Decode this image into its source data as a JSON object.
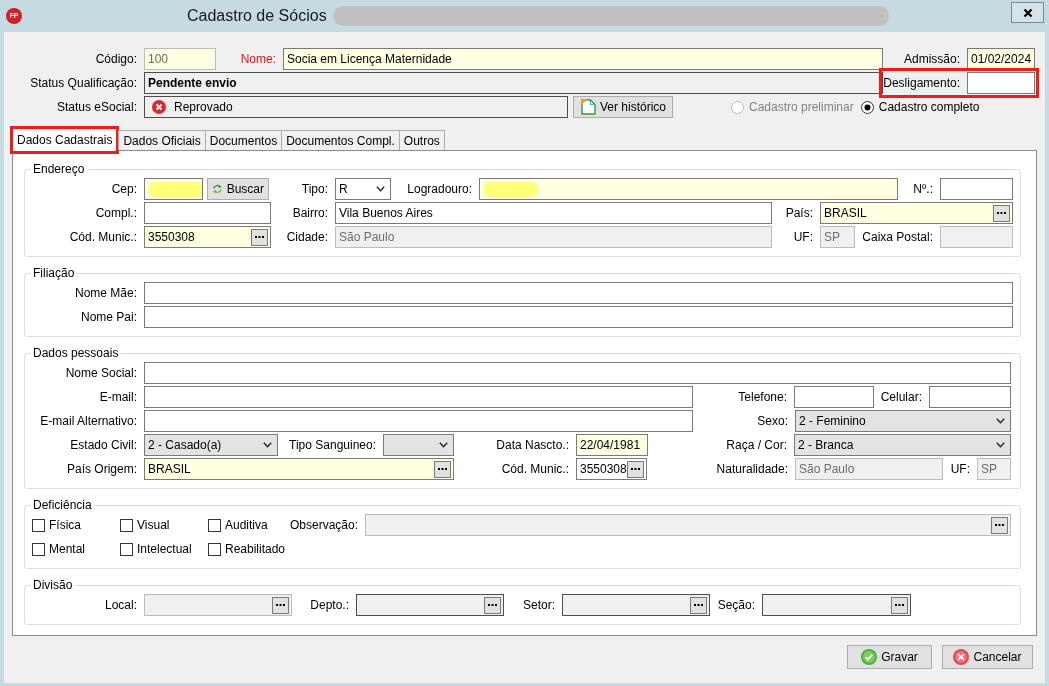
{
  "window": {
    "badge": "FP",
    "title": "Cadastro de Sócios",
    "title_redacted": true
  },
  "header": {
    "fields": [
      {
        "label": "Código:",
        "value": "100",
        "kind": "text",
        "required": true,
        "disabled": true,
        "read_only": false,
        "label_alert": false,
        "highlighted": false
      },
      {
        "label": "Nome:",
        "value": "Socia em Licença Maternidade",
        "kind": "text",
        "required": true,
        "disabled": false,
        "read_only": false,
        "label_alert": true,
        "highlighted": false
      },
      {
        "label": "Admissão:",
        "value": "01/02/2024",
        "kind": "text",
        "required": true,
        "disabled": false,
        "read_only": false,
        "label_alert": false,
        "highlighted": false
      },
      {
        "label": "Status Qualificação:",
        "value": "Pendente envio",
        "kind": "display",
        "required": false,
        "disabled": false,
        "read_only": true,
        "label_alert": false,
        "highlighted": false
      },
      {
        "label": "Desligamento:",
        "kind": "text",
        "required": false,
        "disabled": false,
        "read_only": false,
        "label_alert": false,
        "highlighted": true
      },
      {
        "label": "Status eSocial:",
        "value": "Reprovado",
        "kind": "error-status",
        "required": false,
        "disabled": false,
        "read_only": true,
        "label_alert": false,
        "highlighted": false
      }
    ],
    "history_button": "Ver histórico",
    "registration_modes": [
      {
        "label": "Cadastro preliminar",
        "selected": false,
        "disabled": true
      },
      {
        "label": "Cadastro completo",
        "selected": true,
        "disabled": false
      }
    ]
  },
  "tabs": [
    {
      "label": "Dados Cadastrais",
      "selected": true,
      "highlighted": true
    },
    {
      "label": "Dados Oficiais",
      "selected": false,
      "highlighted": false
    },
    {
      "label": "Documentos",
      "selected": false,
      "highlighted": false
    },
    {
      "label": "Documentos Compl.",
      "selected": false,
      "highlighted": false
    },
    {
      "label": "Outros",
      "selected": false,
      "highlighted": false
    }
  ],
  "sections": [
    {
      "title": "Endereço",
      "kind": "form",
      "fields": [
        {
          "label": "Cep:",
          "kind": "text",
          "required": true,
          "disabled": false,
          "read_only": false,
          "redacted": true,
          "button": "Buscar"
        },
        {
          "label": "Tipo:",
          "value": "R",
          "kind": "combo",
          "required": false,
          "disabled": false,
          "read_only": false,
          "redacted": false
        },
        {
          "label": "Logradouro:",
          "kind": "text",
          "required": true,
          "disabled": false,
          "read_only": false,
          "redacted": true
        },
        {
          "label": "Nº.:",
          "kind": "text",
          "required": false,
          "disabled": false,
          "read_only": false,
          "redacted": false
        },
        {
          "label": "Compl.:",
          "kind": "text",
          "required": false,
          "disabled": false,
          "read_only": false,
          "redacted": false
        },
        {
          "label": "Bairro:",
          "value": "Vila Buenos Aires",
          "kind": "text",
          "required": false,
          "disabled": false,
          "read_only": false,
          "redacted": false
        },
        {
          "label": "País:",
          "value": "BRASIL",
          "kind": "lookup",
          "required": true,
          "disabled": false,
          "read_only": false,
          "redacted": false
        },
        {
          "label": "Cód. Munic.:",
          "value": "3550308",
          "kind": "lookup",
          "required": true,
          "disabled": false,
          "read_only": false,
          "redacted": false
        },
        {
          "label": "Cidade:",
          "value": "São Paulo",
          "kind": "text",
          "required": false,
          "disabled": true,
          "read_only": false,
          "redacted": false
        },
        {
          "label": "UF:",
          "value": "SP",
          "kind": "text",
          "required": false,
          "disabled": true,
          "read_only": false,
          "redacted": false
        },
        {
          "label": "Caixa Postal:",
          "kind": "text",
          "required": false,
          "disabled": true,
          "read_only": false,
          "redacted": false
        }
      ]
    },
    {
      "title": "Filiação",
      "kind": "form",
      "fields": [
        {
          "label": "Nome Mãe:",
          "kind": "text",
          "required": false,
          "disabled": false,
          "read_only": false
        },
        {
          "label": "Nome Pai:",
          "kind": "text",
          "required": false,
          "disabled": false,
          "read_only": false
        }
      ]
    },
    {
      "title": "Dados pessoais",
      "kind": "form",
      "fields": [
        {
          "label": "Nome Social:",
          "kind": "text",
          "required": false,
          "disabled": false,
          "read_only": false
        },
        {
          "label": "E-mail:",
          "kind": "text",
          "required": false,
          "disabled": false,
          "read_only": false
        },
        {
          "label": "Telefone:",
          "kind": "text",
          "required": false,
          "disabled": false,
          "read_only": false
        },
        {
          "label": "Celular:",
          "kind": "text",
          "required": false,
          "disabled": false,
          "read_only": false
        },
        {
          "label": "E-mail Alternativo:",
          "kind": "text",
          "required": false,
          "disabled": false,
          "read_only": false
        },
        {
          "label": "Sexo:",
          "value": "2 - Feminino",
          "kind": "dropdown",
          "required": false,
          "disabled": false,
          "read_only": false
        },
        {
          "label": "Estado Civil:",
          "value": "2 - Casado(a)",
          "kind": "dropdown",
          "required": false,
          "disabled": false,
          "read_only": false
        },
        {
          "label": "Tipo Sanguineo:",
          "kind": "dropdown",
          "required": false,
          "disabled": false,
          "read_only": false
        },
        {
          "label": "Data Nascto.:",
          "value": "22/04/1981",
          "kind": "text",
          "required": true,
          "disabled": false,
          "read_only": false
        },
        {
          "label": "Raça / Cor:",
          "value": "2 - Branca",
          "kind": "dropdown",
          "required": false,
          "disabled": false,
          "read_only": false
        },
        {
          "label": "País Origem:",
          "value": "BRASIL",
          "kind": "lookup",
          "required": true,
          "disabled": false,
          "read_only": false
        },
        {
          "label": "Cód. Munic.:",
          "value": "3550308",
          "kind": "lookup",
          "required": false,
          "disabled": false,
          "read_only": false
        },
        {
          "label": "Naturalidade:",
          "value": "São Paulo",
          "kind": "text",
          "required": false,
          "disabled": true,
          "read_only": false
        },
        {
          "label": "UF:",
          "value": "SP",
          "kind": "text",
          "required": false,
          "disabled": true,
          "read_only": false
        }
      ]
    },
    {
      "title": "Deficiência",
      "kind": "checklist",
      "options": [
        {
          "label": "Física",
          "checked": false
        },
        {
          "label": "Visual",
          "checked": false
        },
        {
          "label": "Auditiva",
          "checked": false
        },
        {
          "label": "Mental",
          "checked": false
        },
        {
          "label": "Intelectual",
          "checked": false
        },
        {
          "label": "Reabilitado",
          "checked": false
        }
      ],
      "observation": {
        "label": "Observação:",
        "kind": "lookup",
        "required": false,
        "disabled": true,
        "read_only": false
      }
    },
    {
      "title": "Divisão",
      "kind": "form",
      "fields": [
        {
          "label": "Local:",
          "kind": "lookup",
          "required": false,
          "disabled": true,
          "read_only": false
        },
        {
          "label": "Depto.:",
          "kind": "lookup",
          "required": false,
          "disabled": false,
          "read_only": true
        },
        {
          "label": "Setor:",
          "kind": "lookup",
          "required": false,
          "disabled": false,
          "read_only": true
        },
        {
          "label": "Seção:",
          "kind": "lookup",
          "required": false,
          "disabled": false,
          "read_only": true
        }
      ]
    }
  ],
  "buttons": [
    {
      "label": "Gravar",
      "kind": "confirm"
    },
    {
      "label": "Cancelar",
      "kind": "cancel"
    }
  ]
}
